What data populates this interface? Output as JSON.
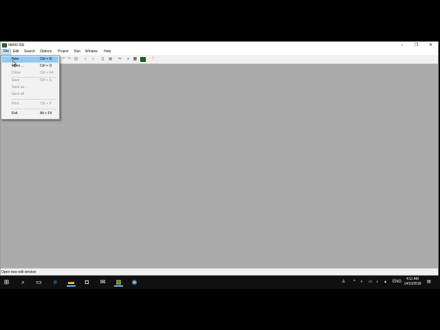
{
  "window": {
    "title": "68000 IDE",
    "controls": {
      "minimize": "–",
      "maximize": "❐",
      "close": "✕"
    }
  },
  "menubar": {
    "items": [
      "File",
      "Edit",
      "Search",
      "Options",
      "Project",
      "Run",
      "Window",
      "Help"
    ],
    "active": "File"
  },
  "file_menu": {
    "items": [
      {
        "label": "New",
        "shortcut": "Ctrl + N",
        "enabled": true,
        "highlighted": true
      },
      {
        "label": "Open ...",
        "shortcut": "Ctrl + O",
        "enabled": true
      },
      {
        "label": "Close",
        "shortcut": "Ctrl + F4",
        "enabled": false
      },
      {
        "label": "Save",
        "shortcut": "Ctrl + S",
        "enabled": false
      },
      {
        "label": "Save as ...",
        "shortcut": "",
        "enabled": false
      },
      {
        "label": "Save all",
        "shortcut": "",
        "enabled": false
      },
      {
        "label": "Print ...",
        "shortcut": "Ctrl + P",
        "enabled": false
      },
      {
        "label": "Exit",
        "shortcut": "Alt + F4",
        "enabled": true
      }
    ]
  },
  "toolbar": {
    "icons": [
      "undo-icon",
      "redo-icon",
      "copy-icon",
      "find-icon",
      "find-next-icon",
      "print-preview-icon",
      "export-icon",
      "tools-icon",
      "zoom-icon",
      "memory-icon",
      "run-icon",
      "help-icon"
    ]
  },
  "statusbar": {
    "text": "Open new edit window"
  },
  "taskbar": {
    "apps": [
      "windows-start-icon",
      "search-icon",
      "task-view-icon",
      "edge-icon",
      "file-explorer-icon",
      "store-icon",
      "mail-icon",
      "ide-app-icon",
      "other-app-icon"
    ],
    "tray": {
      "language": "ENG",
      "time": "4:11 AM",
      "date": "14/10/2018"
    }
  },
  "colors": {
    "client_bg": "#ababab",
    "menu_highlight": "#91c9f7",
    "taskbar": "#101010"
  }
}
